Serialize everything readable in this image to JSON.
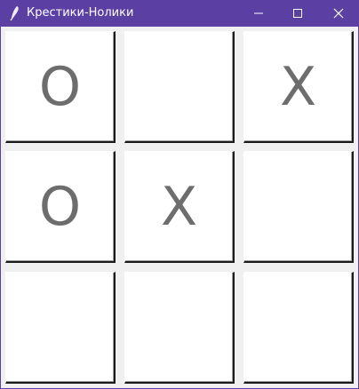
{
  "window": {
    "title": "Крестики-Нолики",
    "icons": {
      "app": "feather-icon",
      "minimize": "minimize-icon",
      "maximize": "maximize-icon",
      "close": "close-icon"
    },
    "titlebar_color": "#5b3fa3"
  },
  "board": {
    "cells": [
      "O",
      "",
      "X",
      "O",
      "X",
      "",
      "",
      "",
      ""
    ],
    "mark_color": "#6d6d6d"
  }
}
